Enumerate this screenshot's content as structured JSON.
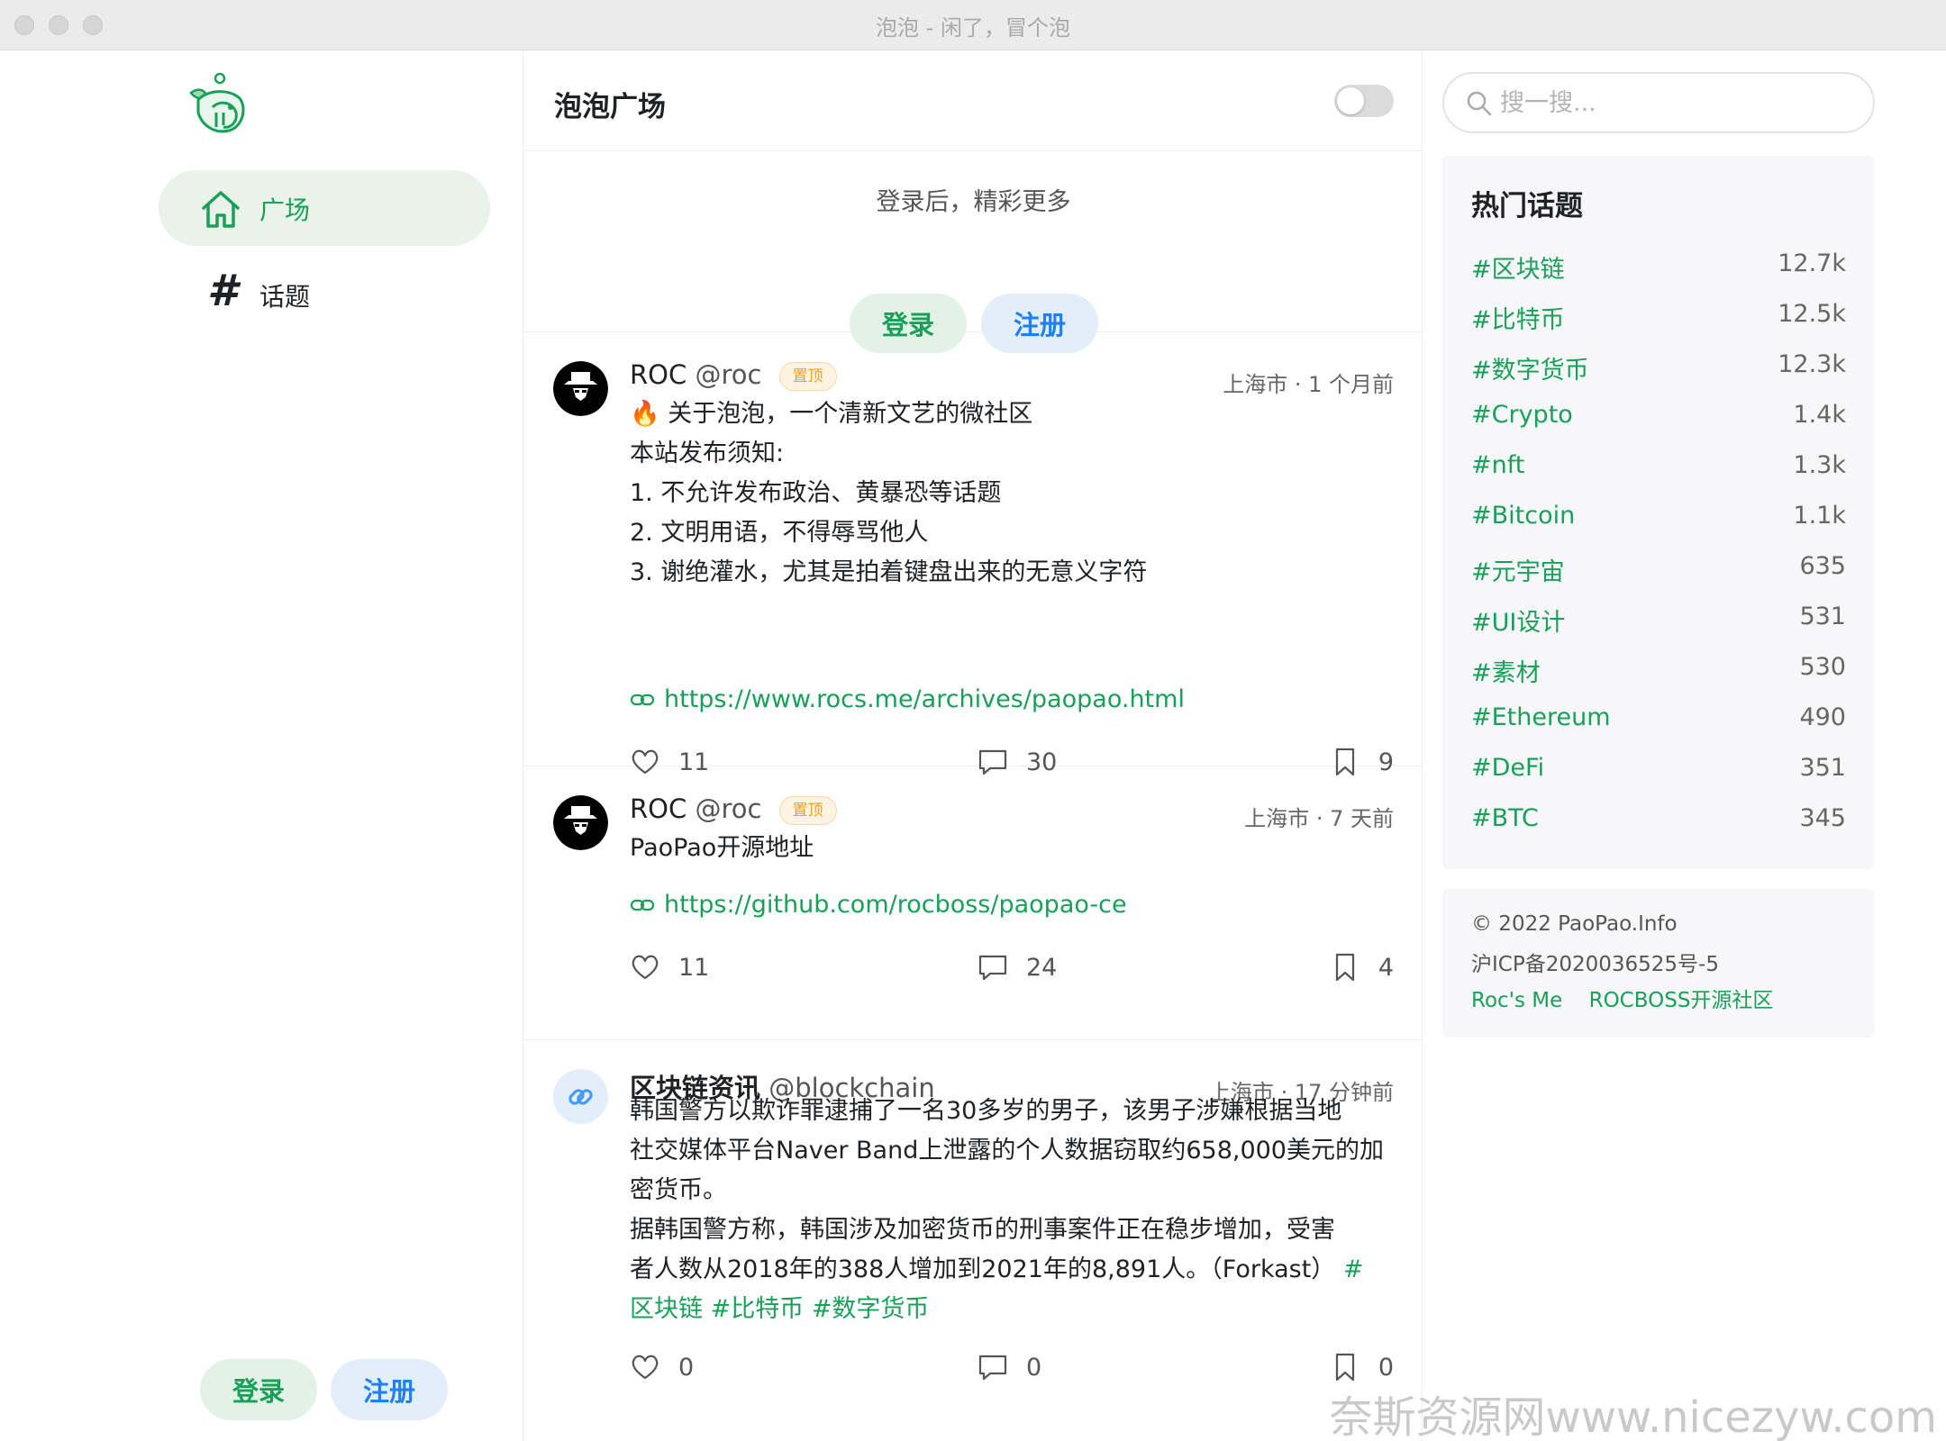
{
  "window": {
    "title": "泡泡 - 闲了，冒个泡"
  },
  "sidebar": {
    "items": [
      {
        "label": "广场",
        "icon": "home-icon"
      },
      {
        "label": "话题",
        "icon": "hash-icon"
      }
    ],
    "login_label": "登录",
    "register_label": "注册"
  },
  "main": {
    "title": "泡泡广场",
    "prompt": {
      "text": "登录后，精彩更多",
      "login_label": "登录",
      "register_label": "注册"
    },
    "posts": [
      {
        "name": "ROC",
        "handle": "@roc",
        "badge": "置顶",
        "meta": "上海市 · 1 个月前",
        "lines": [
          "🔥 关于泡泡，一个清新文艺的微社区",
          "本站发布须知:",
          "1. 不允许发布政治、黄暴恐等话题",
          "2. 文明用语，不得辱骂他人",
          "3. 谢绝灌水，尤其是拍着键盘出来的无意义字符"
        ],
        "link": "https://www.rocs.me/archives/paopao.html",
        "likes": "11",
        "comments": "30",
        "collections": "9"
      },
      {
        "name": "ROC",
        "handle": "@roc",
        "badge": "置顶",
        "meta": "上海市 · 7 天前",
        "lines": [
          "PaoPao开源地址"
        ],
        "link": "https://github.com/rocboss/paopao-ce",
        "likes": "11",
        "comments": "24",
        "collections": "4"
      },
      {
        "name": "区块链资讯",
        "handle": "@blockchain",
        "meta": "上海市 · 17 分钟前",
        "lines": [
          "韩国警方以欺诈罪逮捕了一名30多岁的男子，该男子涉嫌根据当地",
          "社交媒体平台Naver Band上泄露的个人数据窃取约658,000美元的加",
          "密货币。",
          "据韩国警方称，韩国涉及加密货币的刑事案件正在稳步增加，受害",
          "者人数从2018年的388人增加到2021年的8,891人。（Forkast）"
        ],
        "tag_line_tail": "#",
        "tags": [
          "区块链",
          "#比特币",
          "#数字货币"
        ],
        "likes": "0",
        "comments": "0",
        "collections": "0"
      }
    ]
  },
  "right": {
    "search_placeholder": "搜一搜...",
    "hot_title": "热门话题",
    "topics": [
      {
        "name": "#区块链",
        "count": "12.7k"
      },
      {
        "name": "#比特币",
        "count": "12.5k"
      },
      {
        "name": "#数字货币",
        "count": "12.3k"
      },
      {
        "name": "#Crypto",
        "count": "1.4k"
      },
      {
        "name": "#nft",
        "count": "1.3k"
      },
      {
        "name": "#Bitcoin",
        "count": "1.1k"
      },
      {
        "name": "#元宇宙",
        "count": "635"
      },
      {
        "name": "#UI设计",
        "count": "531"
      },
      {
        "name": "#素材",
        "count": "530"
      },
      {
        "name": "#Ethereum",
        "count": "490"
      },
      {
        "name": "#DeFi",
        "count": "351"
      },
      {
        "name": "#BTC",
        "count": "345"
      }
    ],
    "footer": {
      "copyright": "© 2022 PaoPao.Info",
      "icp": "沪ICP备2020036525号-5",
      "links": [
        "Roc's Me",
        "ROCBOSS开源社区"
      ]
    }
  },
  "watermark": "奈斯资源网www.nicezyw.com",
  "colors": {
    "accent": "#18a058",
    "info": "#2080f0",
    "warning": "#f0a020"
  }
}
